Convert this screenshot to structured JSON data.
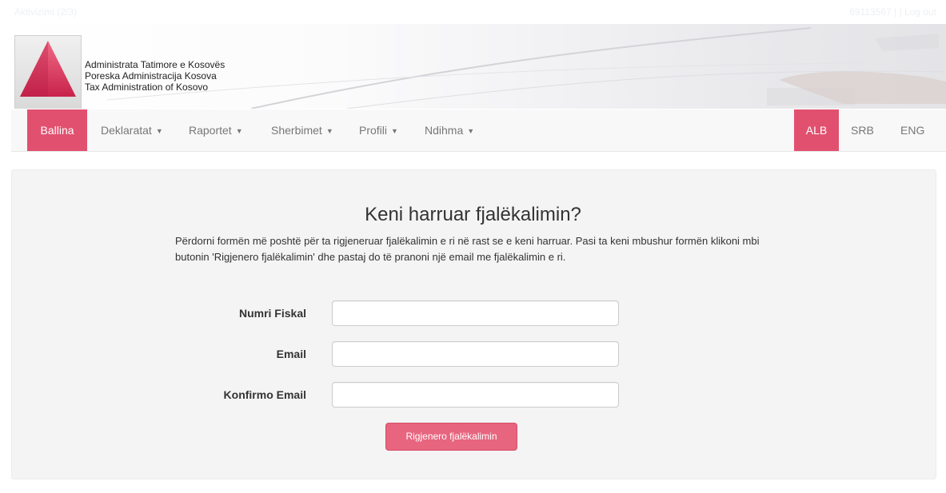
{
  "header": {
    "ghost_left": "Aktivizimi (2/3)",
    "ghost_right": "69113567 | | Log out",
    "org_names": [
      "Administrata Tatimore e Kosovës",
      "Poreska Administracija Kosova",
      "Tax Administration of Kosovo"
    ]
  },
  "nav": {
    "items": [
      {
        "label": "Ballina",
        "active": true
      },
      {
        "label": "Deklaratat",
        "dropdown": true
      },
      {
        "label": "Raportet",
        "dropdown": true
      },
      {
        "label": "Sherbimet",
        "dropdown": true
      },
      {
        "label": "Profili",
        "dropdown": true
      },
      {
        "label": "Ndihma",
        "dropdown": true
      }
    ],
    "languages": [
      {
        "label": "ALB",
        "active": true
      },
      {
        "label": "SRB"
      },
      {
        "label": "ENG"
      }
    ]
  },
  "form": {
    "title": "Keni harruar fjalëkalimin?",
    "description": "Përdorni formën më poshtë për ta rigjeneruar fjalëkalimin e ri në rast se e keni harruar. Pasi ta keni mbushur formën klikoni mbi butonin 'Rigjenero fjalëkalimin' dhe pastaj do të pranoni një email me fjalëkalimin e ri.",
    "fields": [
      {
        "label": "Numri Fiskal",
        "value": ""
      },
      {
        "label": "Email",
        "value": ""
      },
      {
        "label": "Konfirmo Email",
        "value": ""
      }
    ],
    "submit_label": "Rigjenero fjalëkalimin"
  },
  "colors": {
    "accent": "#e2506f",
    "button": "#e8657f"
  }
}
